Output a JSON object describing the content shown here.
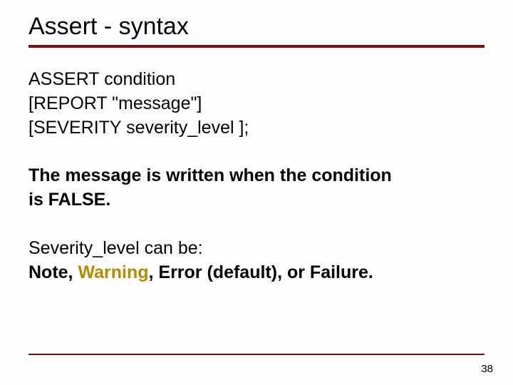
{
  "title": "Assert - syntax",
  "syntax": {
    "line1": "ASSERT  condition",
    "line2": "[REPORT \"message\"]",
    "line3": "[SEVERITY severity_level ];"
  },
  "message_rule": {
    "line1": "The message is written when the condition",
    "line2": "is FALSE."
  },
  "severity": {
    "intro": "Severity_level can be:",
    "note": "Note, ",
    "warning": "Warning",
    "rest": ", Error (default), or Failure."
  },
  "page_number": "38"
}
